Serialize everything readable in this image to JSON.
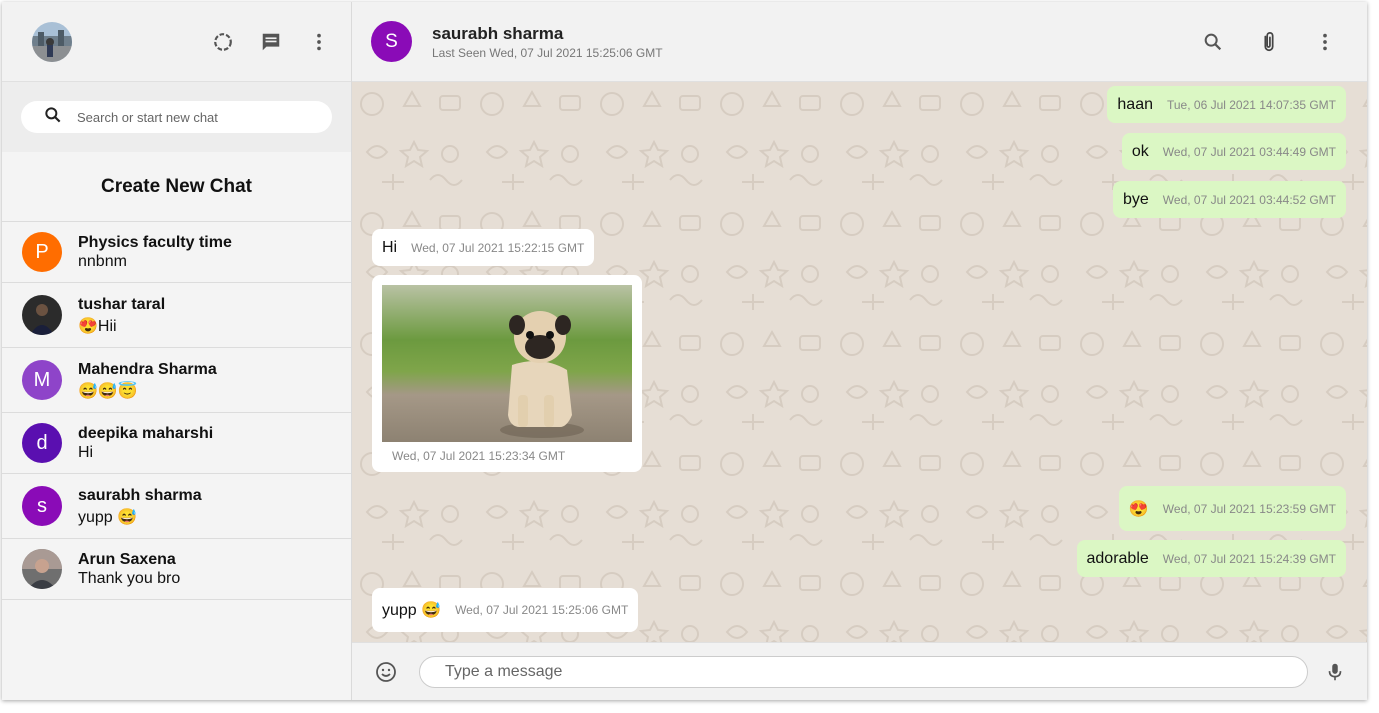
{
  "sidebar": {
    "search_placeholder": "Search or start new chat",
    "create_new_chat": "Create New Chat",
    "chats": [
      {
        "initial": "P",
        "color": "#ff6d00",
        "name": "Physics faculty time",
        "last": "nnbnm"
      },
      {
        "initial": "",
        "color": "#2a2a2a",
        "name": "tushar taral",
        "last": "😍Hii"
      },
      {
        "initial": "M",
        "color": "#8e44c9",
        "name": "Mahendra Sharma",
        "last": "😅😅😇"
      },
      {
        "initial": "d",
        "color": "#5a0fb0",
        "name": "deepika maharshi",
        "last": "Hi"
      },
      {
        "initial": "s",
        "color": "#8a0bb7",
        "name": "saurabh sharma",
        "last": "yupp 😅"
      },
      {
        "initial": "",
        "color": "#555555",
        "name": "Arun Saxena",
        "last": "Thank you bro"
      }
    ]
  },
  "header": {
    "initial": "S",
    "name": "saurabh sharma",
    "status": "Last Seen Wed, 07 Jul 2021 15:25:06 GMT"
  },
  "messages": [
    {
      "text": "haan",
      "time": "Tue, 06 Jul 2021 14:07:35 GMT",
      "dir": "sent"
    },
    {
      "text": "ok",
      "time": "Wed, 07 Jul 2021 03:44:49 GMT",
      "dir": "sent"
    },
    {
      "text": "bye",
      "time": "Wed, 07 Jul 2021 03:44:52 GMT",
      "dir": "sent"
    },
    {
      "text": "Hi",
      "time": "Wed, 07 Jul 2021 15:22:15 GMT",
      "dir": "recv"
    },
    {
      "text": "",
      "time": "Wed, 07 Jul 2021 15:23:34 GMT",
      "dir": "recv",
      "image": "pug-photo"
    },
    {
      "text": "😍",
      "time": "Wed, 07 Jul 2021 15:23:59 GMT",
      "dir": "sent"
    },
    {
      "text": "adorable",
      "time": "Wed, 07 Jul 2021 15:24:39 GMT",
      "dir": "sent"
    },
    {
      "text": "yupp 😅",
      "time": "Wed, 07 Jul 2021 15:25:06 GMT",
      "dir": "recv"
    }
  ],
  "composer": {
    "placeholder": "Type a message"
  },
  "icons": {
    "sidebar_actions": [
      "status-icon",
      "new-chat-icon",
      "more-vert-icon"
    ],
    "header_actions": [
      "search-icon",
      "attach-icon",
      "more-vert-icon"
    ],
    "composer": [
      "emoji-icon",
      "mic-icon"
    ]
  },
  "colors": {
    "sent_bubble": "#dbf7c4",
    "recv_bubble": "#ffffff",
    "chat_background": "#e6ded5"
  }
}
